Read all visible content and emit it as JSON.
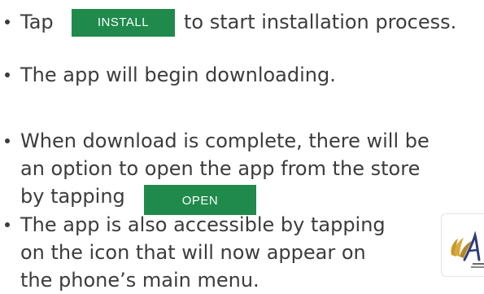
{
  "steps": [
    {
      "pre": "Tap",
      "button": "INSTALL",
      "post": "to start installation process."
    },
    {
      "text": "The app will begin downloading."
    },
    {
      "lines": [
        "When download is complete, there will be",
        "an option to open the app from the store",
        "by tapping"
      ],
      "button": "OPEN"
    },
    {
      "lines": [
        "The app is also accessible by tapping",
        "on the icon that will now appear on",
        "the phone’s main menu."
      ]
    }
  ],
  "colors": {
    "text": "#3c3c3c",
    "button": "#1f8a4c",
    "button_text": "#ffffff"
  },
  "icons": [
    "app-logo-icon"
  ]
}
